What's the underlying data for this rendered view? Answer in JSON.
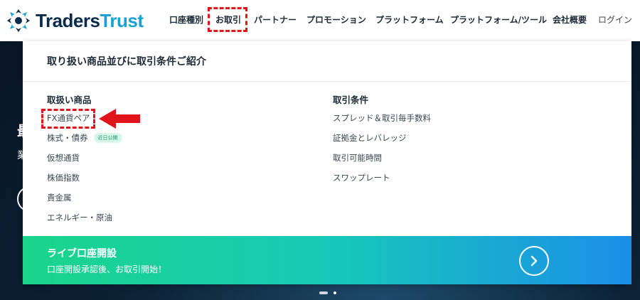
{
  "header": {
    "logo_text_a": "Traders",
    "logo_text_b": "Trust",
    "nav": [
      {
        "label": "口座種別"
      },
      {
        "label": "お取引"
      },
      {
        "label": "パートナー"
      },
      {
        "label": "プロモーション"
      },
      {
        "label": "プラットフォーム"
      },
      {
        "label": "プラットフォーム/ツール"
      },
      {
        "label": "会社概要"
      },
      {
        "label": "ログイン"
      }
    ]
  },
  "hero": {
    "text_a": "最",
    "text_b": "業"
  },
  "menu": {
    "title": "取り扱い商品並びに取引条件ご紹介",
    "products": {
      "heading": "取扱い商品",
      "items": [
        {
          "label": "FX通貨ペア"
        },
        {
          "label": "株式・債券",
          "badge": "近日公開"
        },
        {
          "label": "仮想通貨"
        },
        {
          "label": "株価指数"
        },
        {
          "label": "貴金属"
        },
        {
          "label": "エネルギー・原油"
        }
      ]
    },
    "conditions": {
      "heading": "取引条件",
      "items": [
        {
          "label": "スプレッド＆取引毎手数料"
        },
        {
          "label": "証拠金とレバレッジ"
        },
        {
          "label": "取引可能時間"
        },
        {
          "label": "スワップレート"
        }
      ]
    }
  },
  "cta": {
    "title": "ライブ口座開設",
    "subtitle": "口座開設承認後、お取引開始！",
    "icon": "chevron-right-icon"
  },
  "colors": {
    "highlight": "#e1141b",
    "brand_navy": "#0b2b4a",
    "brand_blue": "#1aa0d8"
  }
}
